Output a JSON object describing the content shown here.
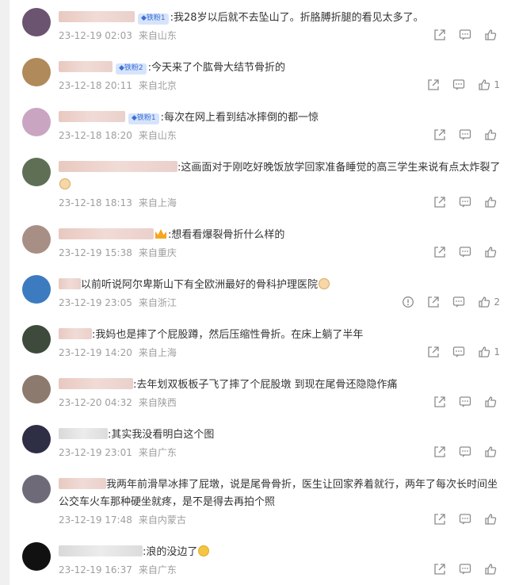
{
  "comments": [
    {
      "text": ":我28岁以后就不去坠山了。折胳膊折腿的看见太多了。",
      "badge": "铁粉1",
      "date": "23-12-19 02:03",
      "location": "来自山东",
      "likes": "",
      "avatar_color": "#6b5470"
    },
    {
      "text": ":今天来了个肱骨大结节骨折的",
      "badge": "铁粉2",
      "date": "23-12-18 20:11",
      "location": "来自北京",
      "likes": "1",
      "avatar_color": "#b08a5a"
    },
    {
      "text": ":每次在网上看到结冰摔倒的都一惊",
      "badge": "铁粉1",
      "date": "23-12-18 18:20",
      "location": "来自山东",
      "likes": "",
      "avatar_color": "#c9a5c2"
    },
    {
      "text": ":这画面对于刚吃好晚饭放学回家准备睡觉的高三学生来说有点太炸裂了",
      "badge": "",
      "date": "23-12-18 18:13",
      "location": "来自上海",
      "likes": "",
      "avatar_color": "#5f6f55"
    },
    {
      "text": ":想看看爆裂骨折什么样的",
      "badge": "",
      "date": "23-12-19 15:38",
      "location": "来自重庆",
      "likes": "",
      "avatar_color": "#a88f86"
    },
    {
      "text": "以前听说阿尔卑斯山下有全欧洲最好的骨科护理医院",
      "badge": "",
      "date": "23-12-19 23:05",
      "location": "来自浙江",
      "likes": "2",
      "avatar_color": "#3c7bbf"
    },
    {
      "text": ":我妈也是摔了个屁股蹲，然后压缩性骨折。在床上躺了半年",
      "badge": "",
      "date": "23-12-19 14:20",
      "location": "来自上海",
      "likes": "1",
      "avatar_color": "#3d4a3c"
    },
    {
      "text": ":去年划双板板子飞了摔了个屁股墩   到现在尾骨还隐隐作痛",
      "badge": "",
      "date": "23-12-20 04:32",
      "location": "来自陕西",
      "likes": "",
      "avatar_color": "#8d7a6e"
    },
    {
      "text": ":其实我没看明白这个图",
      "badge": "",
      "date": "23-12-19 23:01",
      "location": "来自广东",
      "likes": "",
      "avatar_color": "#2e2f45"
    },
    {
      "text": "我两年前滑旱冰摔了屁墩，说是尾骨骨折，医生让回家养着就行，两年了每次长时间坐公交车火车那种硬坐就疼，是不是得去再拍个照",
      "badge": "",
      "date": "23-12-19 17:48",
      "location": "来自内蒙古",
      "likes": "",
      "avatar_color": "#6e6a78"
    },
    {
      "text": ":浪的没边了",
      "badge": "",
      "date": "23-12-19 16:37",
      "location": "来自广东",
      "likes": "",
      "avatar_color": "#111111"
    }
  ],
  "icons": {
    "share": "share-icon",
    "comment": "comment-icon",
    "like": "like-icon",
    "report": "report-icon"
  }
}
